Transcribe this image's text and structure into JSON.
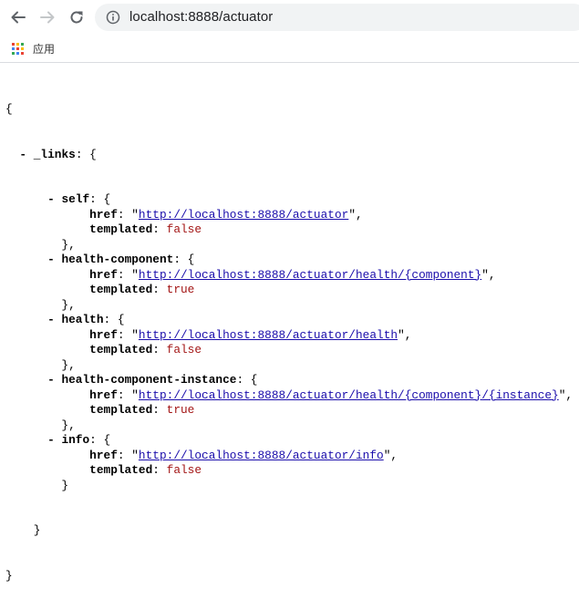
{
  "browser": {
    "url": "localhost:8888/actuator",
    "bookmark_apps_label": "应用"
  },
  "json_view": {
    "open_brace": "{",
    "close_brace": "}",
    "toggle": "-",
    "links_key": "_links",
    "href_key": "href",
    "templated_key": "templated",
    "entries": [
      {
        "key": "self",
        "href": "http://localhost:8888/actuator",
        "templated": "false"
      },
      {
        "key": "health-component",
        "href": "http://localhost:8888/actuator/health/{component}",
        "templated": "true"
      },
      {
        "key": "health",
        "href": "http://localhost:8888/actuator/health",
        "templated": "false"
      },
      {
        "key": "health-component-instance",
        "href": "http://localhost:8888/actuator/health/{component}/{instance}",
        "templated": "true"
      },
      {
        "key": "info",
        "href": "http://localhost:8888/actuator/info",
        "templated": "false"
      }
    ]
  }
}
